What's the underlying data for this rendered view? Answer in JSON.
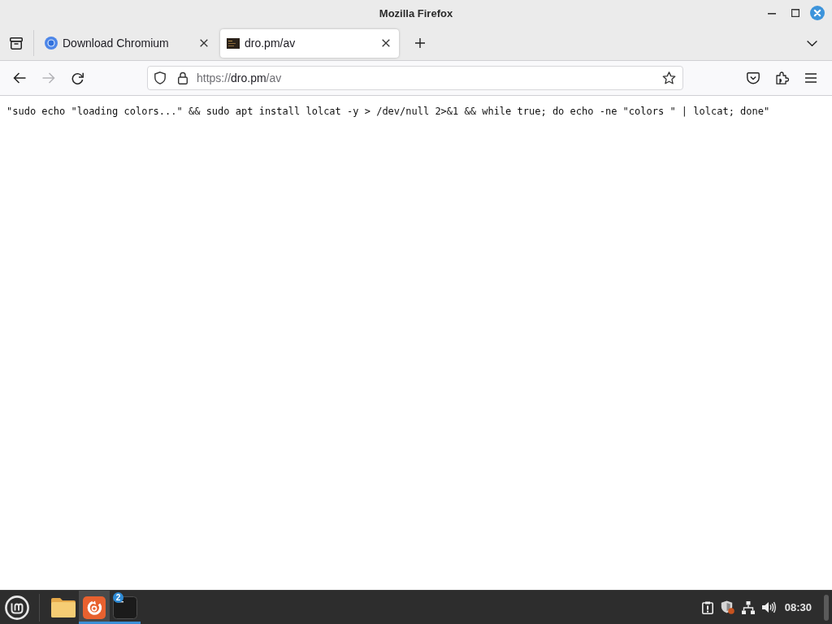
{
  "window": {
    "title": "Mozilla Firefox"
  },
  "tabs": [
    {
      "label": "Download Chromium",
      "kind": "logo",
      "selected": false
    },
    {
      "label": "dro.pm/av",
      "kind": "image",
      "selected": true
    }
  ],
  "nav_buttons": [
    {
      "kind": "back",
      "disabled": false
    },
    {
      "kind": "forward",
      "disabled": true
    },
    {
      "kind": "reload",
      "disabled": false
    }
  ],
  "address_bar": {
    "scheme": "https://",
    "host": "dro.pm",
    "path": "/av"
  },
  "page": {
    "text": "\"sudo echo \"loading colors...\" && sudo apt install lolcat -y > /dev/null 2>&1 && while true; do echo -ne \"colors \" | lolcat; done\""
  },
  "taskbar": {
    "apps": [
      {
        "kind": "folder",
        "running": false,
        "selected": false
      },
      {
        "kind": "browser",
        "running": true,
        "selected": true
      },
      {
        "kind": "terminal",
        "running": true,
        "selected": false,
        "badge": "2"
      }
    ],
    "clock": "08:30"
  }
}
